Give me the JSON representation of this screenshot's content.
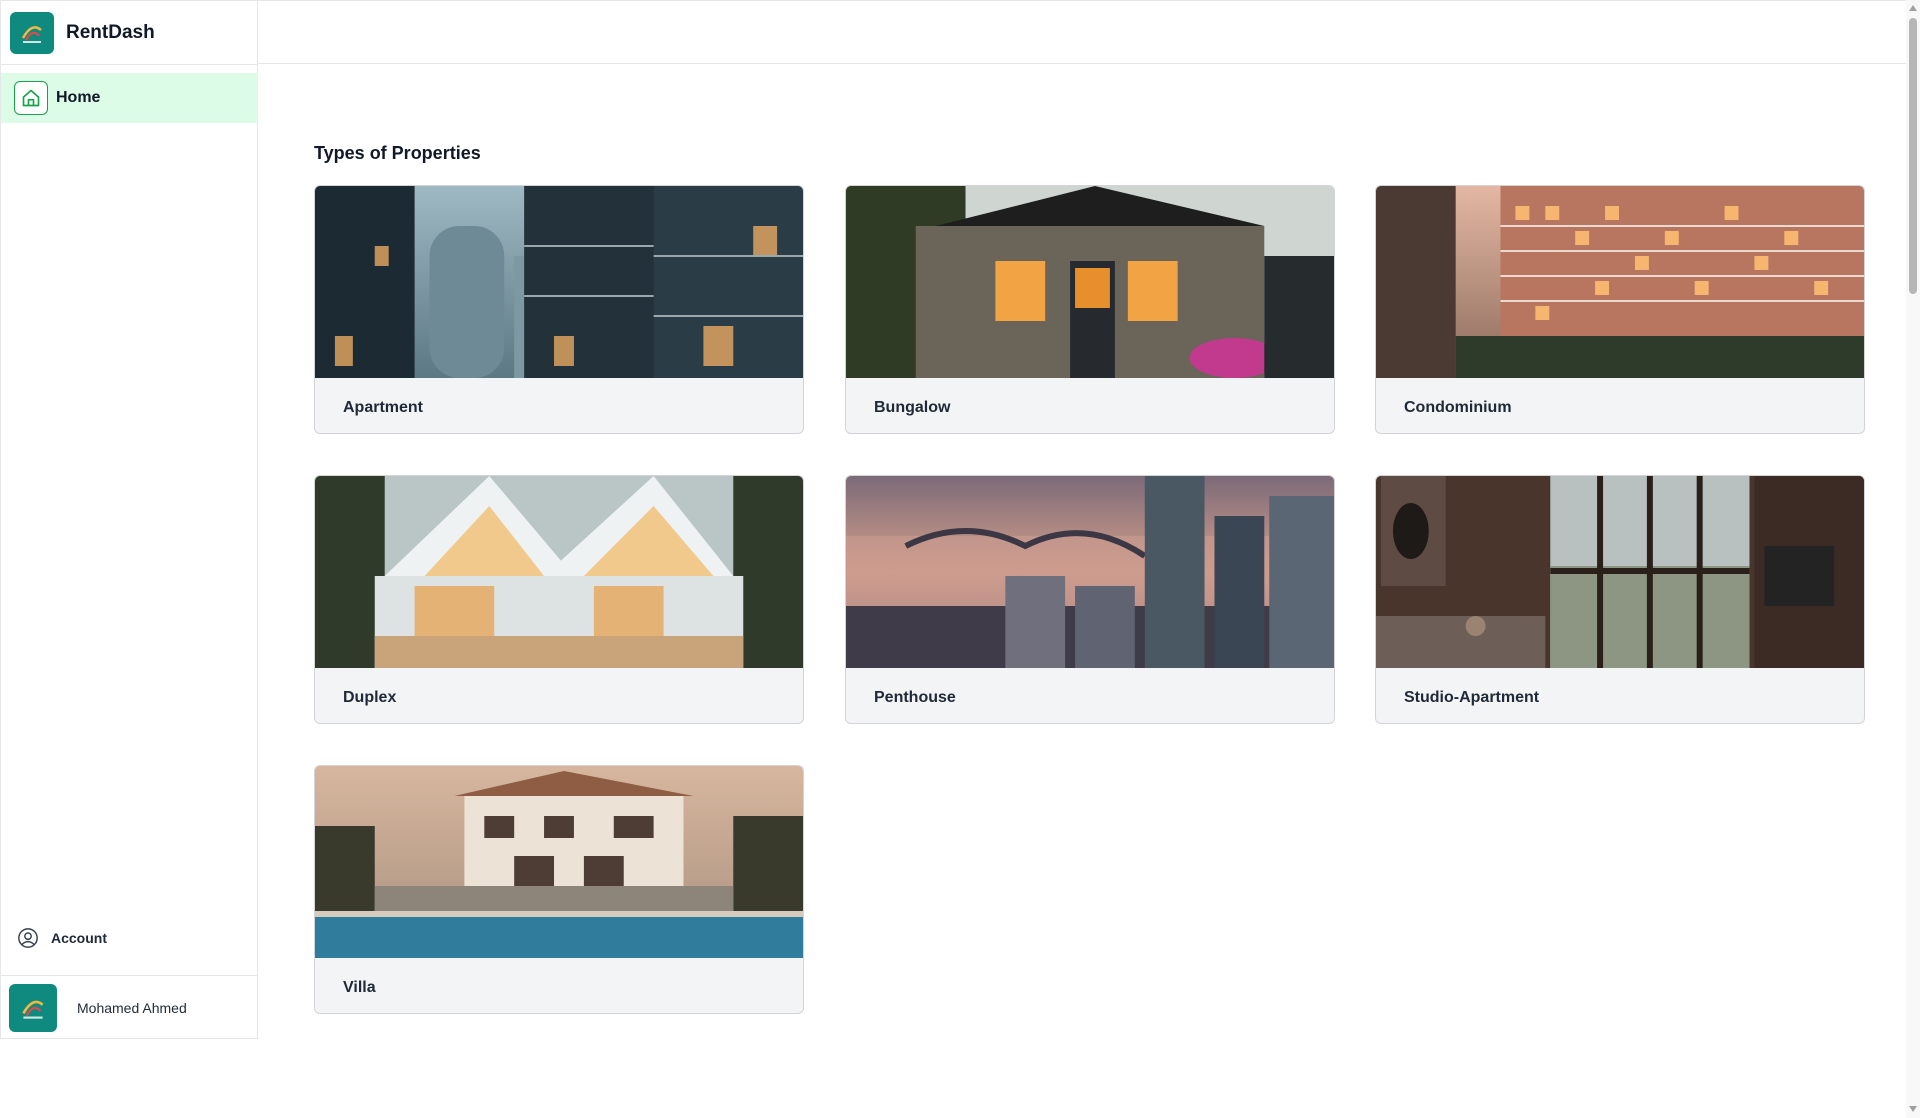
{
  "app": {
    "brand": "RentDash"
  },
  "sidebar": {
    "nav": [
      {
        "label": "Home",
        "icon": "home-icon",
        "active": true
      }
    ],
    "account_label": "Account",
    "user_name": "Mohamed Ahmed"
  },
  "main": {
    "section_title": "Types of Properties",
    "properties": [
      {
        "label": "Apartment"
      },
      {
        "label": "Bungalow"
      },
      {
        "label": "Condominium"
      },
      {
        "label": "Duplex"
      },
      {
        "label": "Penthouse"
      },
      {
        "label": "Studio-Apartment"
      },
      {
        "label": "Villa"
      }
    ]
  },
  "colors": {
    "brand": "#0f8a7e",
    "active_nav": "#dcfce7",
    "active_icon": "#16a34a"
  }
}
